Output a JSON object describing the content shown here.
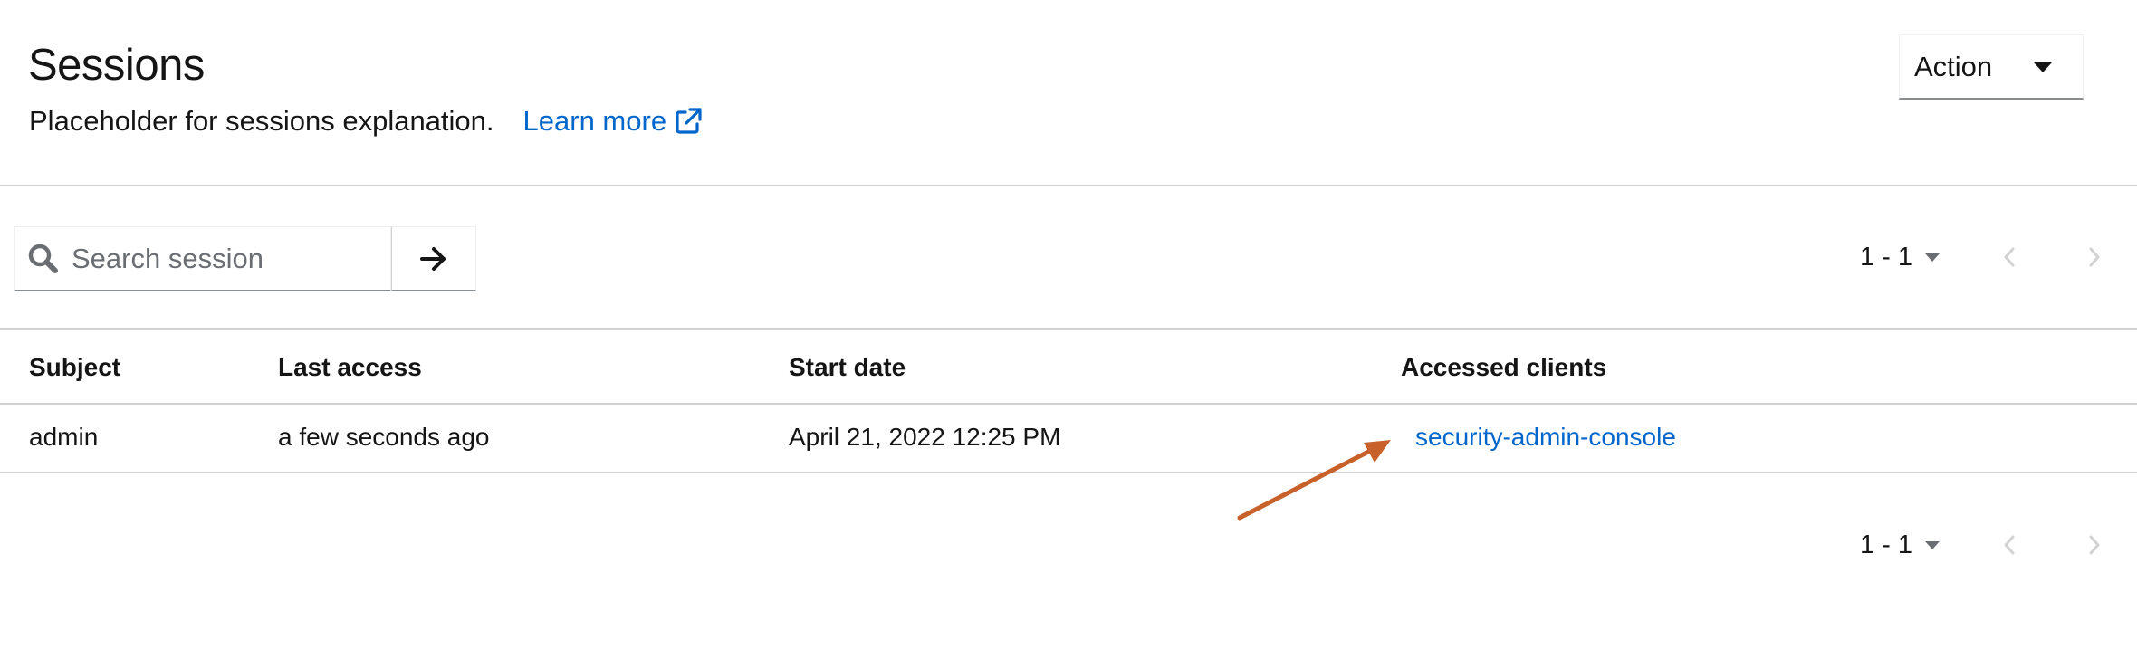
{
  "header": {
    "title": "Sessions",
    "description": "Placeholder for sessions explanation.",
    "learn_more_label": "Learn more",
    "action_label": "Action"
  },
  "toolbar": {
    "search_placeholder": "Search session",
    "search_value": "",
    "pagination_range": "1 - 1"
  },
  "table": {
    "columns": {
      "subject": "Subject",
      "last_access": "Last access",
      "start_date": "Start date",
      "accessed_clients": "Accessed clients"
    },
    "rows": [
      {
        "subject": "admin",
        "last_access": "a few seconds ago",
        "start_date": "April 21, 2022 12:25 PM",
        "accessed_clients": "security-admin-console"
      }
    ]
  },
  "footer": {
    "pagination_range": "1 - 1"
  },
  "icons": {
    "search": "search-icon",
    "submit": "arrow-right-icon",
    "external_link": "external-link-icon",
    "prev": "chevron-left-icon",
    "next": "chevron-right-icon",
    "dropdown": "caret-down-icon"
  },
  "colors": {
    "link": "#0066cc",
    "annotation_arrow": "#c8602a",
    "divider": "#d2d2d2",
    "disabled_nav": "#d2d2d2"
  }
}
